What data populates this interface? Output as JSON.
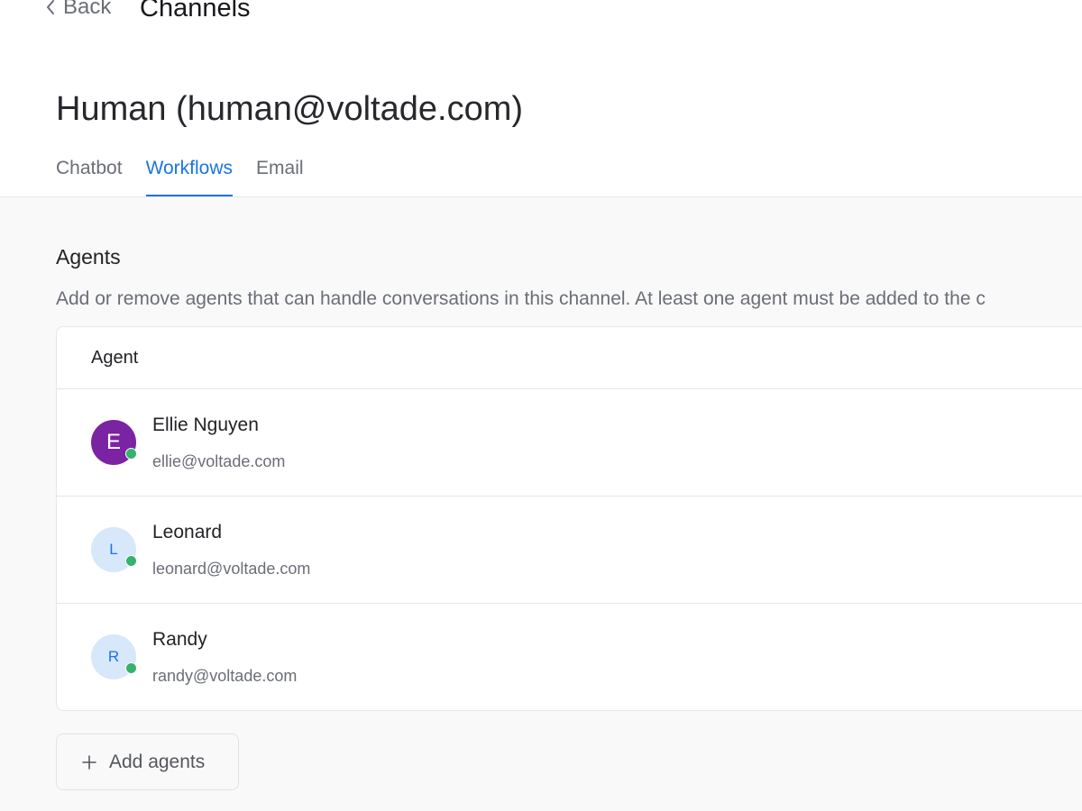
{
  "header": {
    "back_label": "Back",
    "breadcrumb_title": "Channels"
  },
  "page": {
    "title": "Human (human@voltade.com)"
  },
  "tabs": [
    {
      "label": "Chatbot",
      "active": false
    },
    {
      "label": "Workflows",
      "active": true
    },
    {
      "label": "Email",
      "active": false
    }
  ],
  "agents_section": {
    "title": "Agents",
    "description": "Add or remove agents that can handle conversations in this channel. At least one agent must be added to the c",
    "table_header": "Agent",
    "agents": [
      {
        "initial": "E",
        "name": "Ellie Nguyen",
        "email": "ellie@voltade.com",
        "online": true
      },
      {
        "initial": "L",
        "name": "Leonard",
        "email": "leonard@voltade.com",
        "online": true
      },
      {
        "initial": "R",
        "name": "Randy",
        "email": "randy@voltade.com",
        "online": true
      }
    ],
    "add_button_label": "Add agents"
  },
  "colors": {
    "accent": "#1c74e3",
    "online": "#35b26b",
    "avatar_primary": "#7a23a3",
    "avatar_light": "#d6e8fa"
  }
}
